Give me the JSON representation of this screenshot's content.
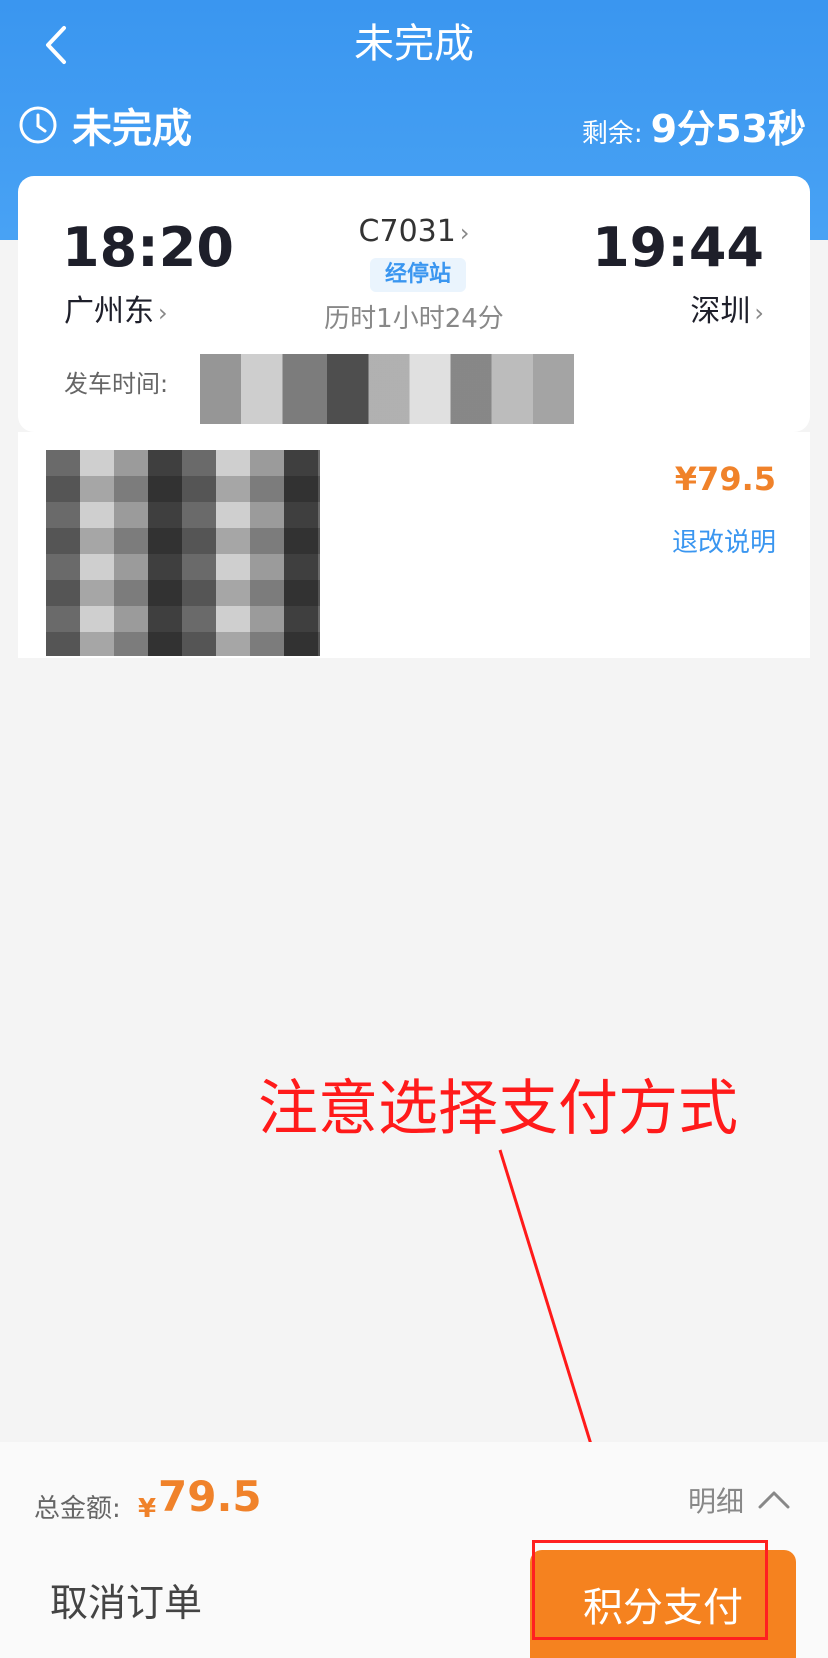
{
  "nav": {
    "title": "未完成"
  },
  "status": {
    "label": "未完成",
    "remaining_label": "剩余:",
    "remaining_value": "9分53秒"
  },
  "trip": {
    "departure_time": "18:20",
    "arrival_time": "19:44",
    "departure_station": "广州东",
    "arrival_station": "深圳",
    "train_number": "C7031",
    "stops_tag": "经停站",
    "duration": "历时1小时24分",
    "depart_time_label": "发车时间:"
  },
  "passenger": {
    "price": "¥79.5",
    "refund_rules": "退改说明"
  },
  "annotation": {
    "text": "注意选择支付方式"
  },
  "footer": {
    "total_label": "总金额:",
    "currency": "¥",
    "total_value": "79.5",
    "detail_label": "明细",
    "cancel_label": "取消订单",
    "pay_label": "积分支付"
  },
  "colors": {
    "primary": "#3a96f0",
    "accent": "#f5821f",
    "annotation": "#ff1a1a"
  },
  "icons": {
    "back": "chevron-left-icon",
    "clock": "clock-icon",
    "detail": "chevron-up-icon"
  }
}
